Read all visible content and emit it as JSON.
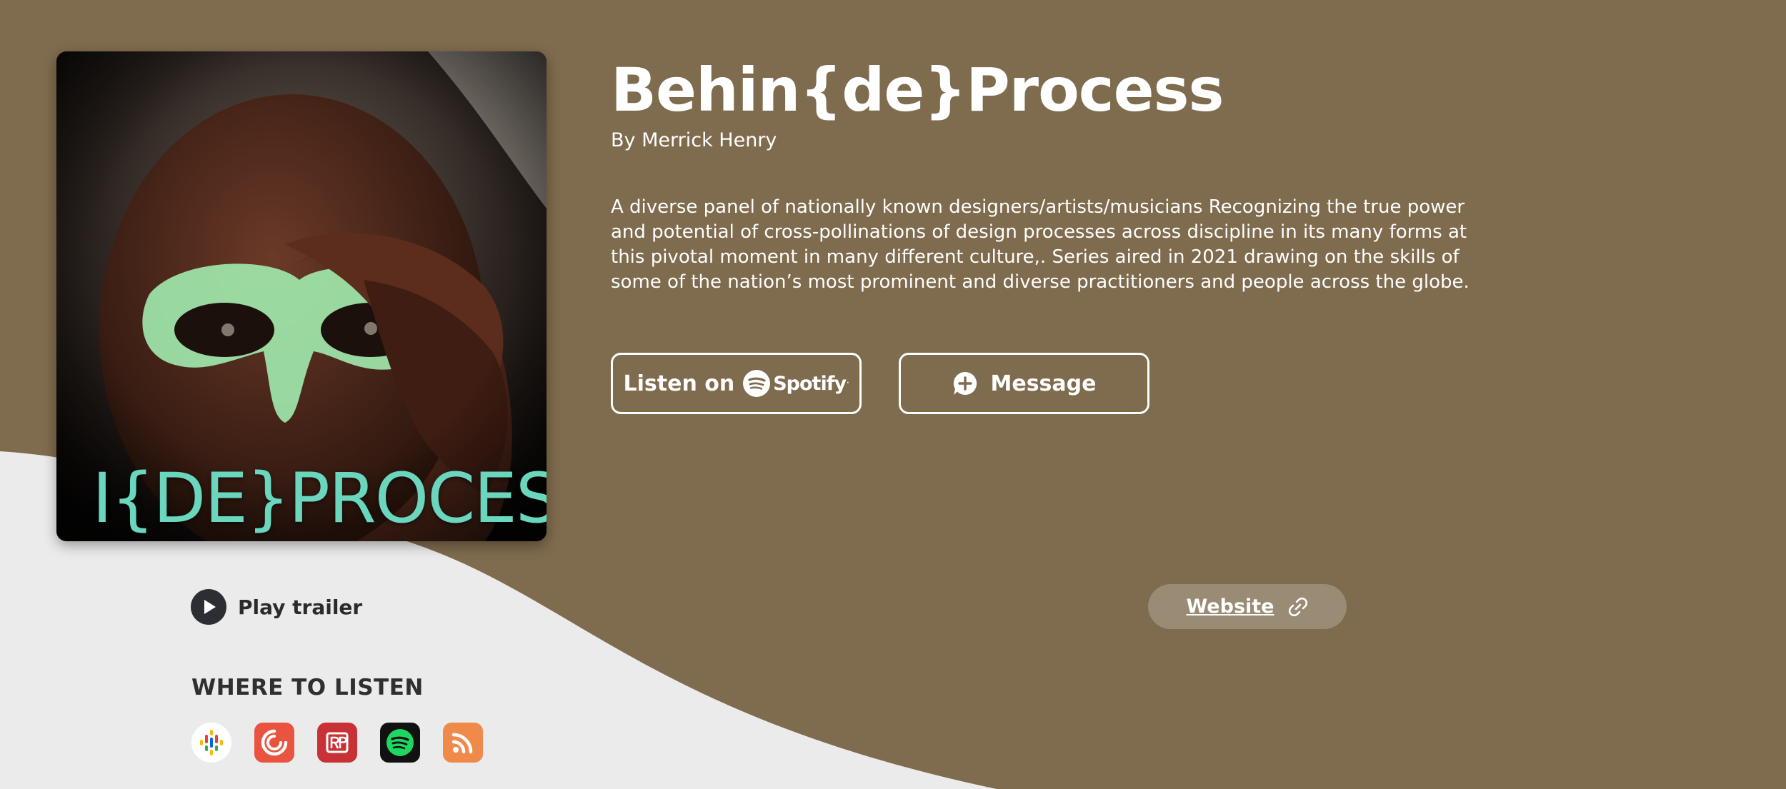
{
  "podcast": {
    "title": "Behin{de}Process",
    "author": "By Merrick Henry",
    "description": "A diverse panel of nationally known designers/artists/musicians Recognizing the true power and potential of cross-pollinations of design processes across discipline in its many forms at this pivotal moment in many different culture,. Series aired in 2021 drawing on the skills of some of the nation’s most prominent and diverse practitioners and people across the globe.",
    "cover_text": "I{DE}PROCESS"
  },
  "actions": {
    "listen_label": "Listen on",
    "spotify_word": "Spotify",
    "message_label": "Message",
    "trailer_label": "Play trailer",
    "website_label": "Website"
  },
  "where_to_listen": {
    "heading": "WHERE TO LISTEN",
    "platforms": [
      {
        "icon": "google-podcasts-icon",
        "color": "#ffffff"
      },
      {
        "icon": "pocket-casts-icon",
        "color": "#e9533f"
      },
      {
        "icon": "radiopublic-icon",
        "color": "#c83236"
      },
      {
        "icon": "spotify-icon",
        "color": "#1ed760"
      },
      {
        "icon": "rss-icon",
        "color": "#f08a4b"
      }
    ]
  },
  "colors": {
    "background": "#7f6b4d",
    "wave": "#ebebeb",
    "accent_teal": "#6ad6bd"
  }
}
